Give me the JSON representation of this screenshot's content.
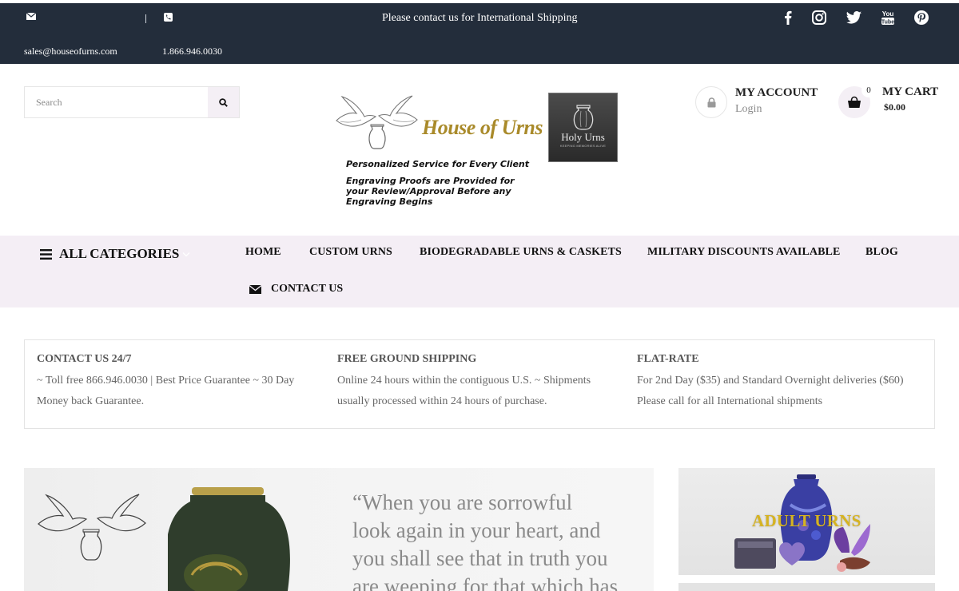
{
  "topbar": {
    "email": "sales@houseofurns.com",
    "phone": "1.866.946.0030",
    "shipping_notice": "Please contact us for International Shipping",
    "social_icons": [
      "facebook-icon",
      "instagram-icon",
      "twitter-icon",
      "youtube-icon",
      "pinterest-icon"
    ],
    "youtube_label": "You Tube"
  },
  "header": {
    "search_placeholder": "Search",
    "logo_text": "House of Urns",
    "partner_badge": {
      "name": "Holy Urns",
      "subtitle": "KEEPING MEMORIES ALIVE"
    },
    "tagline_1": "Personalized Service for Every Client",
    "tagline_2": "Engraving Proofs are Provided for your Review/Approval Before any Engraving Begins",
    "account": {
      "title": "MY ACCOUNT",
      "login": "Login"
    },
    "cart": {
      "title": "MY CART",
      "amount": "$0.00",
      "count": "0"
    }
  },
  "nav": {
    "all_categories": "ALL CATEGORIES",
    "items": [
      "HOME",
      "CUSTOM URNS",
      "BIODEGRADABLE URNS & CASKETS",
      "MILITARY DISCOUNTS AVAILABLE",
      "BLOG"
    ],
    "contact": "CONTACT US"
  },
  "info": [
    {
      "title": "CONTACT US 24/7",
      "text": "~ Toll free 866.946.0030 | Best Price Guarantee ~ 30 Day Money back Guarantee."
    },
    {
      "title": "FREE GROUND SHIPPING",
      "text": "Online 24 hours within the contiguous U.S. ~ Shipments usually processed within 24 hours of purchase."
    },
    {
      "title": "FLAT-RATE",
      "text": "For 2nd Day ($35) and Standard Overnight deliveries ($60) Please call for all International shipments"
    }
  ],
  "hero": {
    "quote_lines": [
      "“When you are sorrowful",
      "look again in your heart, and",
      "you shall see that in truth you",
      "are weeping for that which has"
    ]
  },
  "side_banner": {
    "label": "ADULT URNS"
  },
  "colors": {
    "topbar_bg": "#232d3b",
    "nav_bg": "#f4eef5",
    "logo_gold": "#a98a2a",
    "banner_label": "#d6b321"
  }
}
